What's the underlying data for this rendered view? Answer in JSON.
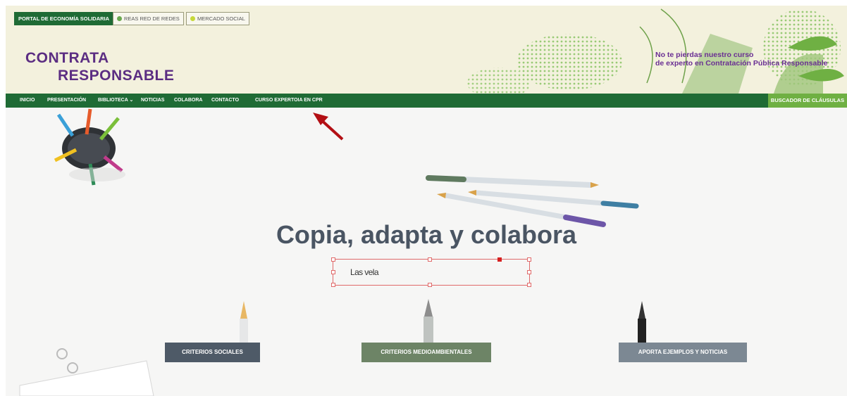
{
  "topbar": {
    "links": [
      {
        "label": "PORTAL DE ECONOMÍA SOLIDARIA"
      },
      {
        "label": "REAS RED DE REDES",
        "dot_color": "#6aa84f"
      },
      {
        "label": "MERCADO SOCIAL",
        "dot_color": "#c6d83a"
      }
    ]
  },
  "logo": {
    "line1": "CONTRATA",
    "line2": "RESPONSABLE"
  },
  "promo": {
    "line1": "No te pierdas nuestro curso",
    "line2": "de experto en Contratación Pública Responsable"
  },
  "nav": {
    "items": [
      {
        "label": "INICIO"
      },
      {
        "label": "PRESENTACIÓN"
      },
      {
        "label": "BIBLIOTECA ⌄"
      },
      {
        "label": "NOTICIAS"
      },
      {
        "label": "COLABORA"
      },
      {
        "label": "CONTACTO"
      },
      {
        "label": "CURSO EXPERTOIA EN CPR"
      }
    ],
    "search_button": "BUSCADOR DE CLÁUSULAS"
  },
  "hero": {
    "title": "Copia, adapta y colabora",
    "editable_text": "Las vela"
  },
  "categories": [
    {
      "label": "CRITERIOS SOCIALES",
      "color": "#4e5a67"
    },
    {
      "label": "CRITERIOS MEDIOAMBIENTALES",
      "color": "#6d8466"
    },
    {
      "label": "APORTA EJEMPLOS Y NOTICIAS",
      "color": "#7c8893"
    }
  ],
  "colors": {
    "brand_green": "#1f6b35",
    "accent_green": "#6fb043",
    "logo_purple": "#5b2d82",
    "annotation_red": "#b30f14"
  }
}
